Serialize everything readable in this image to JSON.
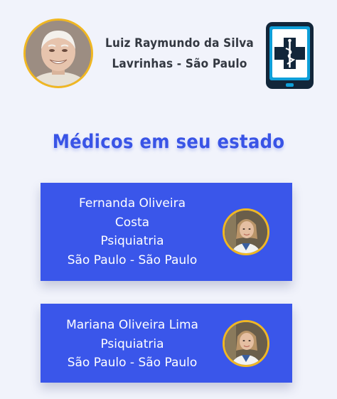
{
  "user": {
    "name": "Luiz Raymundo da Silva",
    "location": "Lavrinhas - São Paulo",
    "avatar_icon": "user-avatar-photo"
  },
  "app": {
    "logo_icon": "medical-tablet-icon"
  },
  "section": {
    "title": "Médicos em seu estado"
  },
  "doctors": [
    {
      "name_line1": "Fernanda Oliveira",
      "name_line2": "Costa",
      "specialty": "Psiquiatria",
      "location": "São Paulo - São Paulo",
      "avatar_icon": "doctor-avatar-photo"
    },
    {
      "name": "Mariana Oliveira Lima",
      "specialty": "Psiquiatria",
      "location": "São Paulo - São Paulo",
      "avatar_icon": "doctor-avatar-photo"
    }
  ],
  "colors": {
    "accent": "#3954e6",
    "card": "#3a56ea",
    "avatar_border": "#f0b722",
    "background": "#f1f3fb",
    "text_dark": "#333841"
  }
}
